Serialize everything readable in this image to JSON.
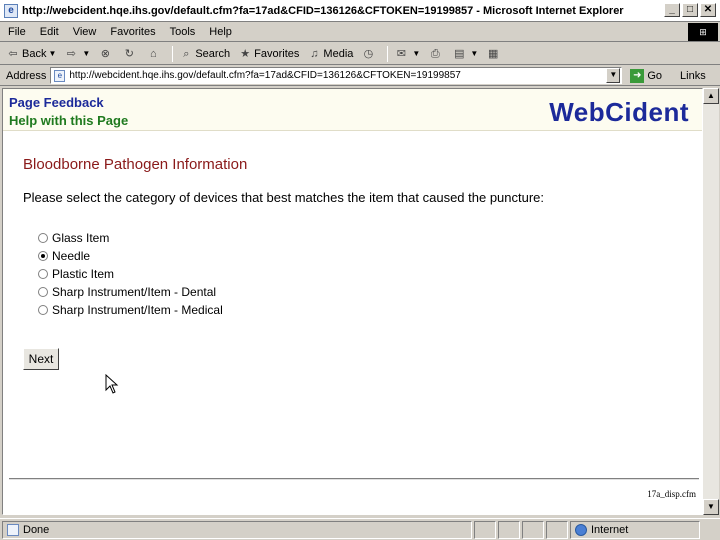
{
  "window": {
    "title": "http://webcident.hqe.ihs.gov/default.cfm?fa=17ad&CFID=136126&CFTOKEN=19199857 - Microsoft Internet Explorer",
    "min_glyph": "_",
    "max_glyph": "□",
    "close_glyph": "✕"
  },
  "menu": {
    "items": [
      {
        "label": "File"
      },
      {
        "label": "Edit"
      },
      {
        "label": "View"
      },
      {
        "label": "Favorites"
      },
      {
        "label": "Tools"
      },
      {
        "label": "Help"
      }
    ]
  },
  "toolbar": {
    "back_label": "Back",
    "search_label": "Search",
    "favorites_label": "Favorites",
    "media_label": "Media"
  },
  "address": {
    "label": "Address",
    "url": "http://webcident.hqe.ihs.gov/default.cfm?fa=17ad&CFID=136126&CFTOKEN=19199857",
    "go_label": "Go",
    "links_label": "Links"
  },
  "page": {
    "header": {
      "page_feedback": "Page Feedback",
      "help_with_page": "Help with this Page",
      "logo": "WebCident"
    },
    "section_title": "Bloodborne Pathogen Information",
    "instructions": "Please select the category of devices that best matches the item that caused the puncture:",
    "options": [
      {
        "label": "Glass Item",
        "selected": false
      },
      {
        "label": "Needle",
        "selected": true
      },
      {
        "label": "Plastic Item",
        "selected": false
      },
      {
        "label": "Sharp Instrument/Item - Dental",
        "selected": false
      },
      {
        "label": "Sharp Instrument/Item - Medical",
        "selected": false
      }
    ],
    "next_label": "Next",
    "footer_file": "17a_disp.cfm"
  },
  "status": {
    "text": "Done",
    "zone": "Internet"
  },
  "colors": {
    "logo": "#1c2a9a",
    "help_link": "#1f7a1f",
    "section_title": "#8a1a1a"
  }
}
